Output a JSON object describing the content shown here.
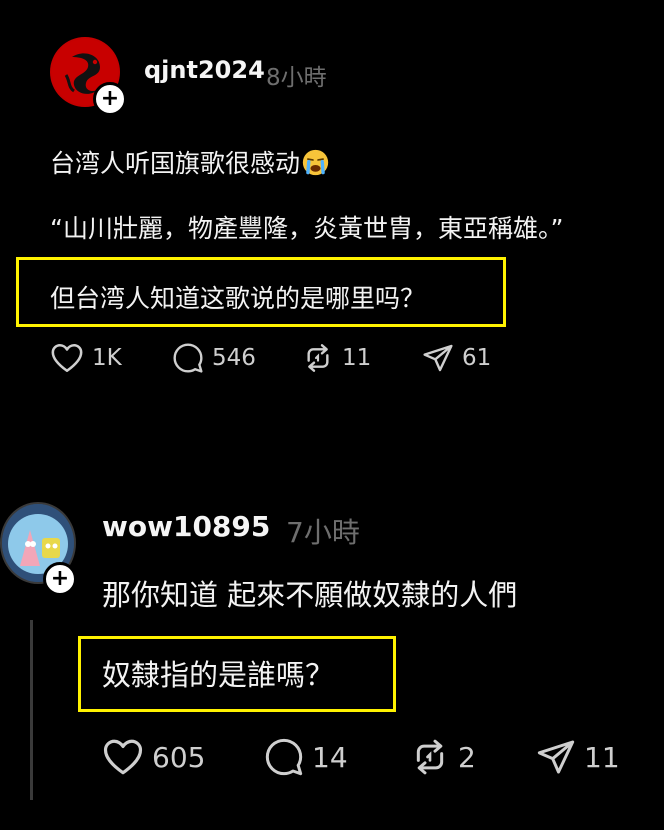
{
  "posts": [
    {
      "username": "qjnt2024",
      "time": "8小時",
      "lines": [
        "台湾人听国旗歌很感动",
        "“山川壯麗，物產豐隆，炎黃世胄，東亞稱雄。”",
        "但台湾人知道这歌说的是哪里吗？"
      ],
      "emoji": "crying-face-icon",
      "actions": {
        "likes": "1K",
        "replies": "546",
        "reposts": "11",
        "shares": "61"
      }
    },
    {
      "username": "wow10895",
      "time": "7小時",
      "lines": [
        "那你知道 起來不願做奴隸的人們",
        "奴隸指的是誰嗎？"
      ],
      "actions": {
        "likes": "605",
        "replies": "14",
        "reposts": "2",
        "shares": "11"
      }
    }
  ],
  "colors": {
    "background": "#000000",
    "text": "#f3f3f3",
    "muted": "#6e6e6e",
    "highlight": "#fff200"
  },
  "icons": [
    "heart-icon",
    "comment-icon",
    "repost-icon",
    "share-icon",
    "plus-icon"
  ]
}
